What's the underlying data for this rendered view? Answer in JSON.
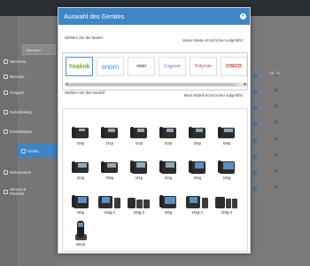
{
  "background": {
    "sidebar_items": [
      {
        "label": "Übersicht",
        "icon": "grid-icon"
      },
      {
        "label": "Nummern",
        "icon": "list-icon"
      },
      {
        "label": "Benutzer",
        "icon": "user-icon"
      },
      {
        "label": "Gruppen",
        "icon": "users-icon"
      },
      {
        "label": "Rufumleitung",
        "icon": "forward-icon"
      },
      {
        "label": "Einstellungen",
        "icon": "gear-icon"
      },
      {
        "label": "Geräte",
        "icon": "phone-icon"
      },
      {
        "label": "Rufnummern",
        "icon": "hash-icon"
      },
      {
        "label": "Service & Preisinfo",
        "icon": "info-icon"
      }
    ],
    "column_header": "Aktion"
  },
  "modal": {
    "title": "Auswahl des Gerätes",
    "brand_prompt": "Wählen Sie die Marke:",
    "brand_missing": "Meine Marke ist nicht hier aufgeführt",
    "brands": [
      "Yealink",
      "snom",
      "mitel",
      "Gigaset",
      "Polycom",
      "CISCO"
    ],
    "selected_brand": "Yealink",
    "model_prompt": "Wählen Sie das Modell:",
    "model_missing": "Mein Modell ist nicht hier aufgeführt",
    "models": [
      [
        "t19p",
        "t21p",
        "t22p",
        "t23p",
        "t26p",
        "t28p"
      ],
      [
        "t32g",
        "t38g",
        "t41p",
        "t42g",
        "t46g",
        "t48g"
      ],
      [
        "t46g",
        "t48g-1",
        "t48g-2",
        "t48g",
        "t48g-1",
        "t48g-2"
      ],
      [
        "w52p"
      ]
    ]
  },
  "colors": {
    "header_blue": "#3f86c8",
    "selected_border": "#4a8fd3",
    "yealink_green": "#6cae29",
    "snom_blue": "#3a8fd0",
    "cisco_red": "#cc2a2a"
  }
}
